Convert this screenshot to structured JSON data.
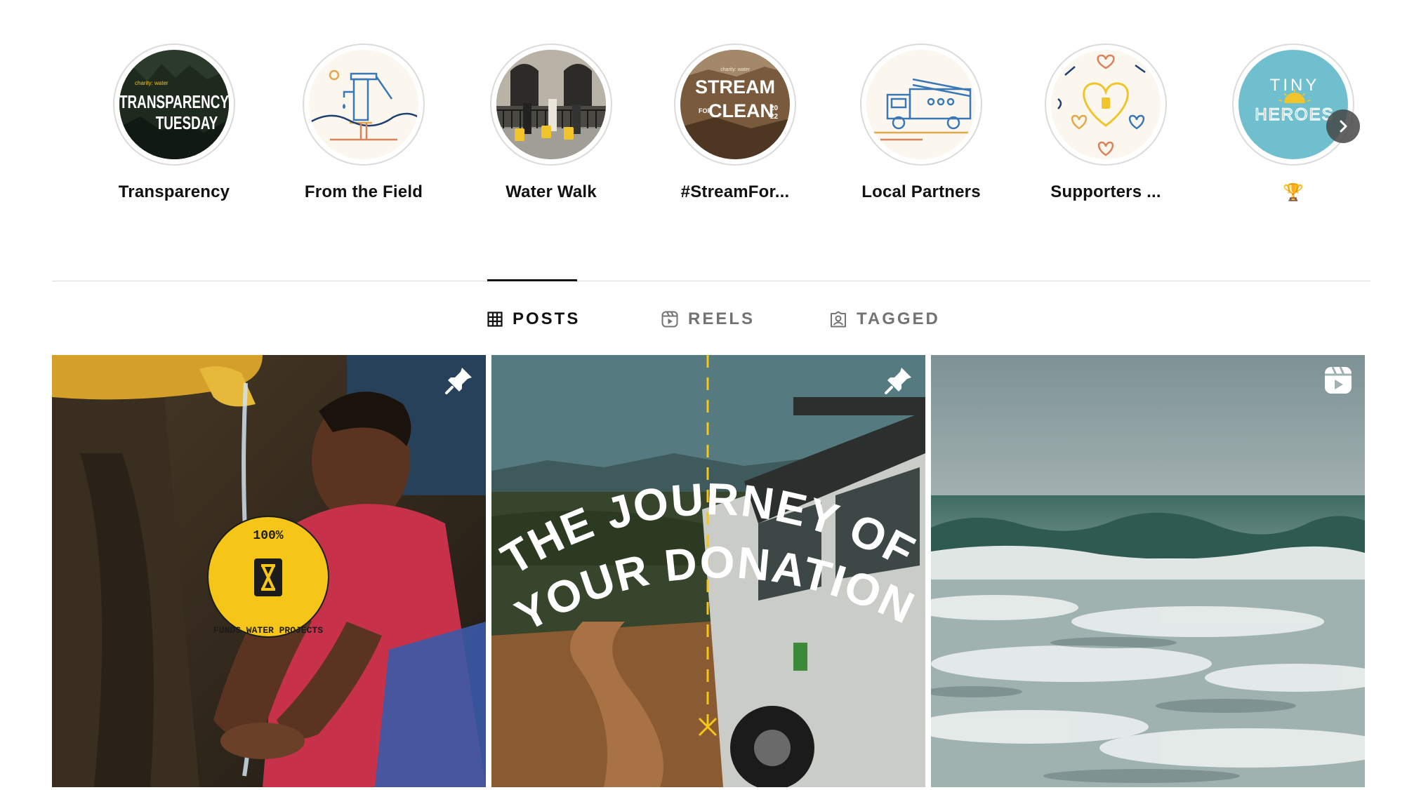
{
  "highlights": [
    {
      "label": "Transparency",
      "cover_text": [
        "charity: water",
        "TRANSPARENCY",
        "TUESDAY"
      ]
    },
    {
      "label": "From the Field"
    },
    {
      "label": "Water Walk"
    },
    {
      "label": "#StreamFor...",
      "cover_text": [
        "charity: water",
        "STREAM",
        "FOR",
        "CLEAN",
        "20",
        "22"
      ]
    },
    {
      "label": "Local Partners"
    },
    {
      "label": "Supporters ..."
    },
    {
      "label": "🏆",
      "cover_text": [
        "TINY",
        "HEROES"
      ]
    }
  ],
  "next_icon": "chevron-right-icon",
  "tabs": [
    {
      "label": "POSTS",
      "icon": "grid-icon",
      "active": true
    },
    {
      "label": "REELS",
      "icon": "reels-icon",
      "active": false
    },
    {
      "label": "TAGGED",
      "icon": "tagged-icon",
      "active": false
    }
  ],
  "posts": [
    {
      "badge": "pin-icon",
      "badge_text": [
        "100%",
        "FUNDS WATER PROJECTS"
      ]
    },
    {
      "badge": "pin-icon",
      "overlay_lines": [
        "THE JOURNEY OF",
        "YOUR DONATION"
      ]
    },
    {
      "badge": "reel-icon"
    }
  ],
  "colors": {
    "brand_yellow": "#f5c518",
    "tab_active": "#111111",
    "tab_inactive": "#737373",
    "divider": "#dbdbdb",
    "tiny_heroes_bg": "#6fbfcf"
  }
}
